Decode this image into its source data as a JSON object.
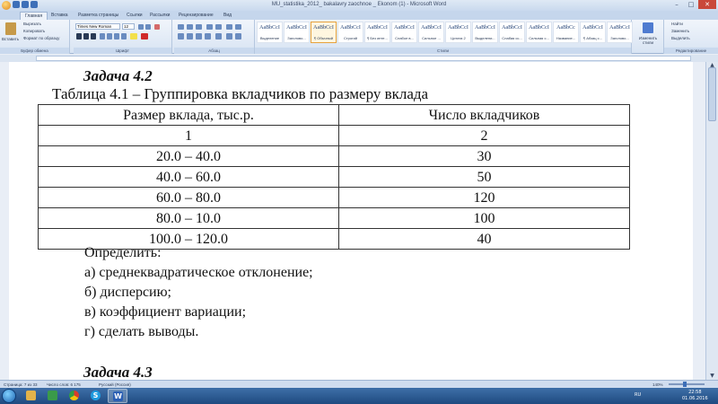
{
  "window": {
    "title": "MU_statistika_2012_ bakalavry zaochnoe _ Ekonom (1) - Microsoft Word",
    "minimize": "–",
    "maximize": "□",
    "close": "✕"
  },
  "tabs": [
    "Главная",
    "Вставка",
    "Разметка страницы",
    "Ссылки",
    "Рассылки",
    "Рецензирование",
    "Вид"
  ],
  "ribbon": {
    "clipboard": {
      "paste": "Вставить",
      "cut": "Вырезать",
      "copy": "Копировать",
      "format_painter": "Формат по образцу",
      "label": "Буфер обмена"
    },
    "font": {
      "name": "Times New Roman",
      "size": "12",
      "label": "Шрифт"
    },
    "paragraph": {
      "label": "Абзац"
    },
    "styles": {
      "items": [
        {
          "sample": "AaBbCcI",
          "name": "Выделение"
        },
        {
          "sample": "AaBbCcI",
          "name": "Заголово..."
        },
        {
          "sample": "AaBbCcI",
          "name": "¶ Обычный"
        },
        {
          "sample": "AaBbCcI",
          "name": "Строгий"
        },
        {
          "sample": "AaBbCcI",
          "name": "¶ Без инте..."
        },
        {
          "sample": "AaBbCcI",
          "name": "Слабое в..."
        },
        {
          "sample": "AaBbCcI",
          "name": "Сильное ..."
        },
        {
          "sample": "AaBbCcI",
          "name": "Цитата 2"
        },
        {
          "sample": "AaBbCcI",
          "name": "Выделени..."
        },
        {
          "sample": "AaBbCcI",
          "name": "Слабая сс..."
        },
        {
          "sample": "AaBbCcI",
          "name": "Сильная с..."
        },
        {
          "sample": "AaBbCc",
          "name": "Название..."
        },
        {
          "sample": "AaBbCcI",
          "name": "¶ Абзац с..."
        },
        {
          "sample": "AaBbCcI",
          "name": "Заголово..."
        }
      ],
      "label": "Стили"
    },
    "change_styles": "Изменить стили",
    "editing": {
      "find": "Найти",
      "replace": "Заменить",
      "select": "Выделить",
      "label": "Редактирование"
    }
  },
  "document": {
    "task_heading": "Задача 4.2",
    "table_caption": "Таблица 4.1 – Группировка вкладчиков по размеру вклада",
    "table": {
      "headers": [
        "Размер вклада, тыс.р.",
        "Число вкладчиков"
      ],
      "rows": [
        [
          "1",
          "2"
        ],
        [
          "20.0 – 40.0",
          "30"
        ],
        [
          "40.0 – 60.0",
          "50"
        ],
        [
          "60.0 – 80.0",
          "120"
        ],
        [
          "80.0 – 10.0",
          "100"
        ],
        [
          "100.0 – 120.0",
          "40"
        ]
      ]
    },
    "questions_intro": "Определить:",
    "questions": [
      "а) среднеквадратическое отклонение;",
      "б) дисперсию;",
      "в) коэффициент вариации;",
      "г) сделать выводы."
    ],
    "next_task_heading": "Задача 4.3"
  },
  "statusbar": {
    "page": "Страница: 7 из 33",
    "words": "Число слов: 6 175",
    "language": "Русский (Россия)",
    "zoom": "140%"
  },
  "taskbar": {
    "lang": "RU",
    "time": "22:58",
    "date": "01.06.2016"
  }
}
